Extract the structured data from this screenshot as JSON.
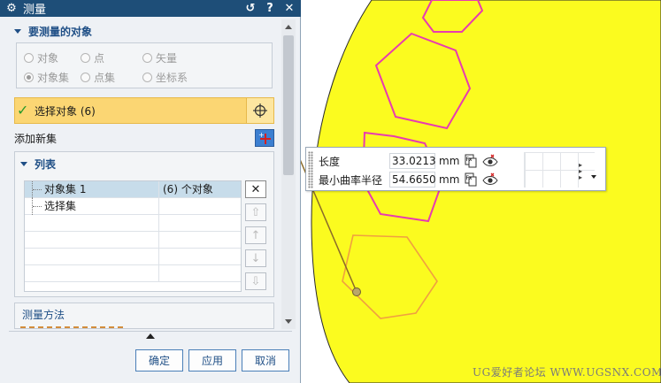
{
  "dialog": {
    "title": "测量",
    "title_buttons": [
      "↺",
      "?",
      "✕"
    ],
    "objects_group": {
      "title": "要测量的对象",
      "radios": [
        {
          "label": "对象",
          "checked": false
        },
        {
          "label": "点",
          "checked": false
        },
        {
          "label": "矢量",
          "checked": false
        },
        {
          "label": "对象集",
          "checked": true
        },
        {
          "label": "点集",
          "checked": false
        },
        {
          "label": "坐标系",
          "checked": false
        }
      ],
      "select_label": "选择对象 (6)",
      "add_new_set": "添加新集"
    },
    "list_group": {
      "title": "列表",
      "rows": [
        {
          "name": "对象集 1",
          "count": "(6) 个对象",
          "selected": true
        },
        {
          "name": "选择集",
          "count": "",
          "selected": false
        }
      ],
      "side_buttons": [
        "✕",
        "⇧",
        "↑",
        "↓",
        "⇩"
      ]
    },
    "method_group": {
      "title": "测量方法"
    },
    "buttons": {
      "ok": "确定",
      "apply": "应用",
      "cancel": "取消"
    }
  },
  "result": {
    "rows": [
      {
        "label": "长度",
        "value": "33.0213",
        "unit": "mm"
      },
      {
        "label": "最小曲率半径",
        "value": "54.6650",
        "unit": "mm"
      }
    ]
  },
  "watermark": "UG爱好者论坛 WWW.UGSNX.COM",
  "colors": {
    "face": "#fbfb1f",
    "hex_edges": "#e83bb0",
    "selected_edge": "#f0a040",
    "title_bar": "#1e4e78",
    "selection_row": "#fbd673",
    "annotation": "#d42020"
  }
}
